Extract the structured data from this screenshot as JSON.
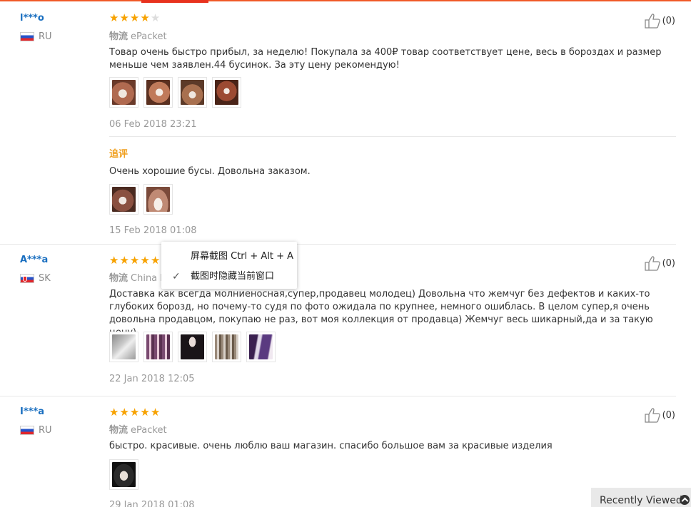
{
  "reviews": [
    {
      "user": "l***o",
      "country": "RU",
      "rating": 4,
      "logistics_label": "物流",
      "logistics": "ePacket",
      "text": "Товар очень быстро прибыл, за неделю! Покупала за 400₽ товар соответствует цене, весь в бороздах и размер меньше чем заявлен.44 бусинок. За эту цену рекомендую!",
      "date": "06 Feb 2018 23:21",
      "helpful": "(0)",
      "additional_label": "追评",
      "additional_text": "Очень хорошие бусы. Довольна заказом.",
      "additional_date": "15 Feb 2018 01:08"
    },
    {
      "user": "A***a",
      "country": "SK",
      "rating": 5,
      "logistics_label": "物流",
      "logistics": "China P",
      "text": "Доставка как всегда молниеносная,супер,продавец молодец) Довольна что жемчуг без дефектов и каких-то глубоких борозд, но почему-то судя по фото ожидала по крупнее, немного ошиблась. В целом супер,я очень довольна продавцом, покупаю не раз, вот моя коллекция от продавца) Жемчуг весь шикарный,да и за такую цену)",
      "date": "22 Jan 2018 12:05",
      "helpful": "(0)"
    },
    {
      "user": "I***a",
      "country": "RU",
      "rating": 5,
      "logistics_label": "物流",
      "logistics": "ePacket",
      "text": "быстро. красивые. очень люблю ваш магазин. спасибо большое вам за красивые изделия",
      "date": "29 Jan 2018 01:08",
      "helpful": "(0)"
    }
  ],
  "context_menu": {
    "item1": "屏幕截图 Ctrl + Alt + A",
    "item2": "截图时隐藏当前窗口"
  },
  "recently_viewed": "Recently Viewed",
  "colors": {
    "accent": "#f05a28",
    "star": "#f7a200",
    "username": "#1a6fc0",
    "additional": "#f0a020"
  },
  "icons": {
    "helpful": "thumbs-up-icon",
    "flag_ru": "russia-flag-icon",
    "flag_sk": "slovakia-flag-icon",
    "check": "check-icon",
    "chevron": "chevron-up-icon"
  }
}
